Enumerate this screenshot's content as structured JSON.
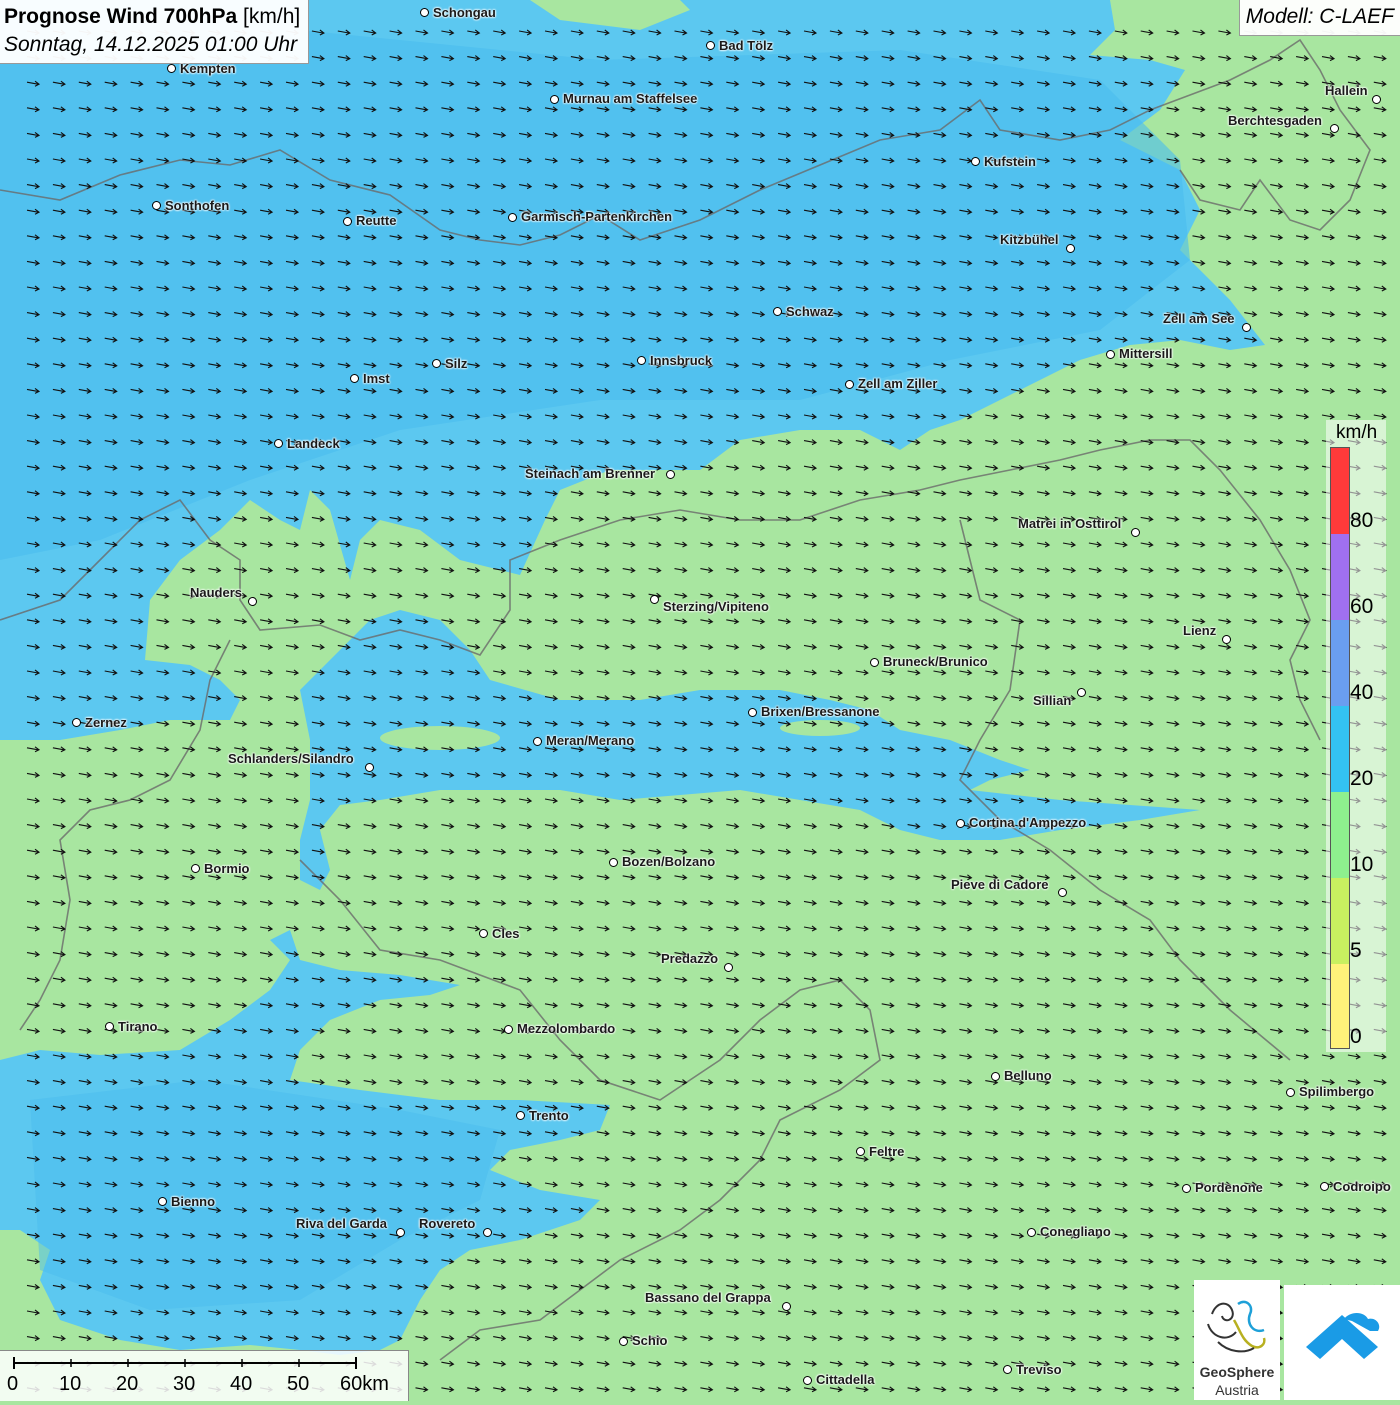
{
  "header": {
    "title_bold": "Prognose Wind 700hPa",
    "title_unit": "[km/h]",
    "datetime": "Sonntag, 14.12.2025 01:00 Uhr",
    "model": "Modell: C-LAEF"
  },
  "legend": {
    "unit": "km/h",
    "labels": [
      "80",
      "60",
      "40",
      "20",
      "10",
      "5",
      "0"
    ],
    "colors": [
      "#ff3a3a",
      "#a070f0",
      "#6a9ef0",
      "#33c2f2",
      "#8ef08e",
      "#c8f060",
      "#fff27a"
    ]
  },
  "map": {
    "colors": {
      "land": "#a8e6a0",
      "wind_band": "#5cc8f0",
      "wind_band_dark": "#3ab2ec",
      "border": "#6a6a6a"
    },
    "arrow_icon": "wind-arrow-icon",
    "cities": [
      {
        "name": "Schongau"
      },
      {
        "name": "Bad Tölz"
      },
      {
        "name": "Kempten"
      },
      {
        "name": "Murnau am Staffelsee"
      },
      {
        "name": "Hallein"
      },
      {
        "name": "Berchtesgaden"
      },
      {
        "name": "Kufstein"
      },
      {
        "name": "Sonthofen"
      },
      {
        "name": "Reutte"
      },
      {
        "name": "Garmisch-Partenkirchen"
      },
      {
        "name": "Kitzbühel"
      },
      {
        "name": "Schwaz"
      },
      {
        "name": "Zell am See"
      },
      {
        "name": "Mittersill"
      },
      {
        "name": "Innsbruck"
      },
      {
        "name": "Silz"
      },
      {
        "name": "Imst"
      },
      {
        "name": "Zell am Ziller"
      },
      {
        "name": "Landeck"
      },
      {
        "name": "Steinach am Brenner"
      },
      {
        "name": "Matrei in Osttirol"
      },
      {
        "name": "Nauders"
      },
      {
        "name": "Sterzing/Vipiteno"
      },
      {
        "name": "Lienz"
      },
      {
        "name": "Bruneck/Brunico"
      },
      {
        "name": "Sillian"
      },
      {
        "name": "Brixen/Bressanone"
      },
      {
        "name": "Zernez"
      },
      {
        "name": "Meran/Merano"
      },
      {
        "name": "Schlanders/Silandro"
      },
      {
        "name": "Cortina d'Ampezzo"
      },
      {
        "name": "Bozen/Bolzano"
      },
      {
        "name": "Bormio"
      },
      {
        "name": "Pieve di Cadore"
      },
      {
        "name": "Cles"
      },
      {
        "name": "Predazzo"
      },
      {
        "name": "Tirano"
      },
      {
        "name": "Mezzolombardo"
      },
      {
        "name": "Belluno"
      },
      {
        "name": "Spilimbergo"
      },
      {
        "name": "Trento"
      },
      {
        "name": "Feltre"
      },
      {
        "name": "Pordenone"
      },
      {
        "name": "Codroipo"
      },
      {
        "name": "Bienno"
      },
      {
        "name": "Riva del Garda"
      },
      {
        "name": "Rovereto"
      },
      {
        "name": "Conegliano"
      },
      {
        "name": "Bassano del Grappa"
      },
      {
        "name": "Schio"
      },
      {
        "name": "Treviso"
      },
      {
        "name": "Cittadella"
      }
    ]
  },
  "scale": {
    "labels": [
      "0",
      "10",
      "20",
      "30",
      "40",
      "50",
      "60km"
    ]
  },
  "logos": {
    "geosphere_line1": "GeoSphere",
    "geosphere_line2": "Austria"
  }
}
